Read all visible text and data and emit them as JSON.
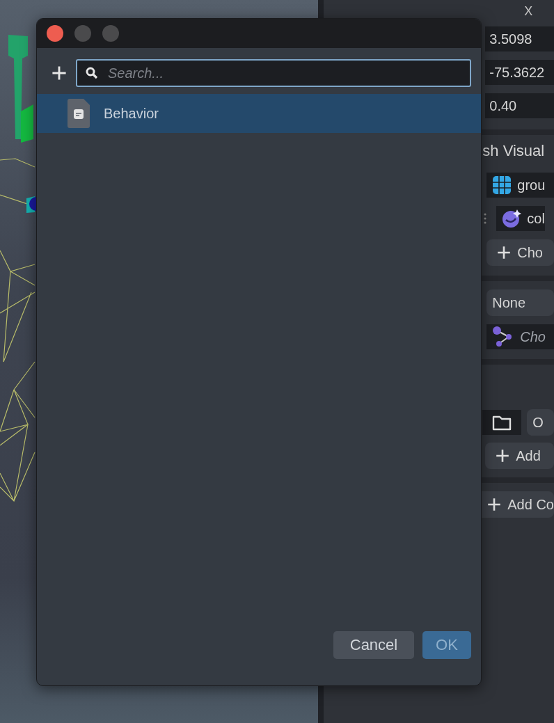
{
  "inspector": {
    "column_header": "X",
    "values": [
      "3.5098",
      "-75.3622",
      "0.40"
    ],
    "section_title": "sh Visual",
    "texture_field": "grou",
    "material_field": "col",
    "choose_button": "Cho",
    "blend_select": "None",
    "node_field": "Cho",
    "folder_field": "O",
    "add_button": "Add",
    "add_component_button": "Add Co"
  },
  "dialog": {
    "search": {
      "placeholder": "Search..."
    },
    "items": [
      {
        "label": "Behavior",
        "selected": true
      }
    ],
    "buttons": [
      {
        "label": "Cancel",
        "kind": "secondary"
      },
      {
        "label": "OK",
        "kind": "primary"
      }
    ]
  }
}
